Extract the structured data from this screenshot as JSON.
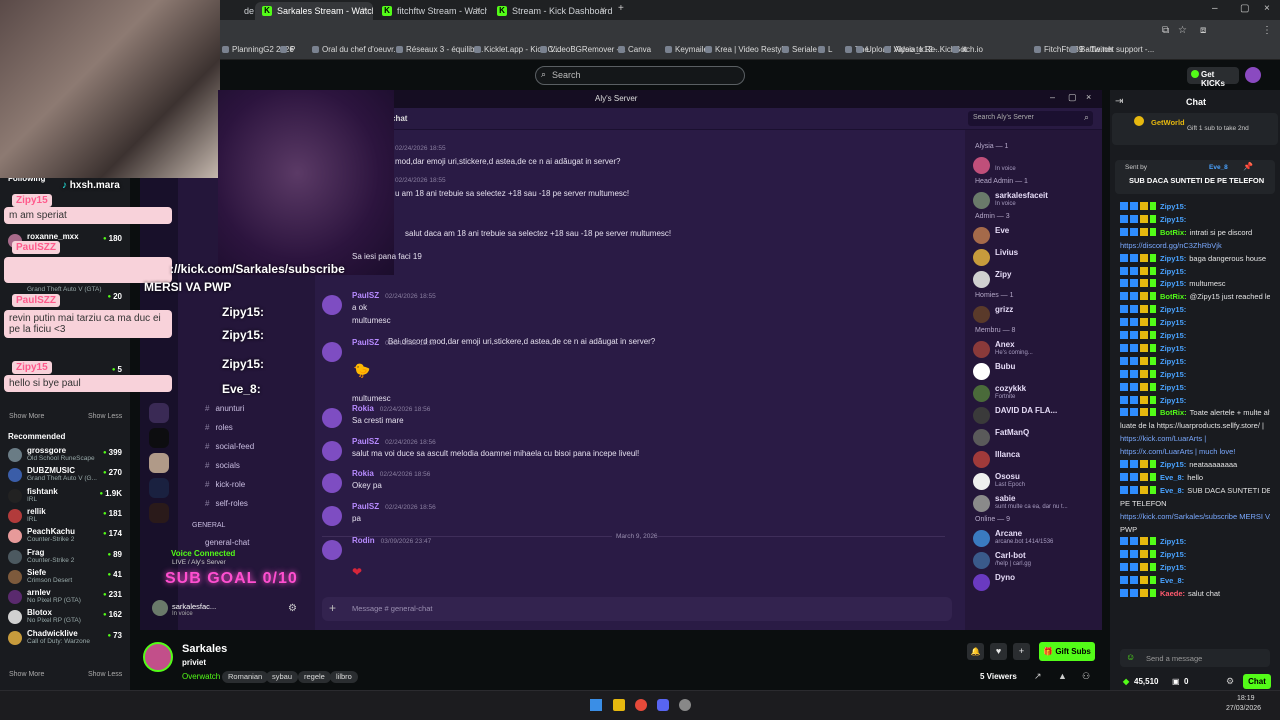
{
  "browser": {
    "tabs": [
      {
        "label": "de fa",
        "active": false
      },
      {
        "label": "Sarkales Stream - Watch Live o",
        "active": true
      },
      {
        "label": "fitchftw Stream - Watch Live o",
        "active": false
      },
      {
        "label": "Stream - Kick Dashboard",
        "active": false
      }
    ],
    "bookmarks": [
      "PlanningG2 2026",
      "P",
      "Oral du chef d'oeuvr...",
      "Réseaux 3 - équilibr...",
      "Kicklet.app - Kick C...",
      "VideoBGRemover -...",
      "Canva",
      "Keymailer",
      "Krea | Video Restyle",
      "Seriale",
      "L",
      "The",
      "Upload Video to Re...",
      "Alysia_k12 - KickBot",
      "itch.io",
      "FitchFtw89 - Twitch",
      "Battle.net support -..."
    ]
  },
  "kick": {
    "search_placeholder": "Search",
    "get_kicks": "Get KICKs",
    "sidebar": {
      "following_label": "Following",
      "recommended_label": "Recommended",
      "show_more": "Show More",
      "show_less": "Show Less",
      "following": [
        {
          "name": "roxanne_mxx",
          "game": "",
          "viewers": "180"
        },
        {
          "name": "PaulSZZ",
          "game": "Grand Theft Auto V (GTA)",
          "viewers": "20"
        },
        {
          "name": "",
          "game": "",
          "viewers": "5"
        }
      ],
      "recommended": [
        {
          "name": "grossgore",
          "game": "Old School RuneScape",
          "viewers": "399",
          "color": "#6a7c85"
        },
        {
          "name": "DUBZMUSIC",
          "game": "Grand Theft Auto V (G...",
          "viewers": "270",
          "color": "#3a5da8"
        },
        {
          "name": "fishtank",
          "game": "IRL",
          "viewers": "1.9K",
          "color": "#222222"
        },
        {
          "name": "rellik",
          "game": "IRL",
          "viewers": "181",
          "color": "#b23b3b"
        },
        {
          "name": "PeachKachu",
          "game": "Counter-Strike 2",
          "viewers": "174",
          "color": "#e79a9a"
        },
        {
          "name": "Frag",
          "game": "Counter-Strike 2",
          "viewers": "89",
          "color": "#4c5960"
        },
        {
          "name": "Siefe",
          "game": "Crimson Desert",
          "viewers": "41",
          "color": "#7d5a3c"
        },
        {
          "name": "arnlev",
          "game": "No Pixel RP (GTA)",
          "viewers": "231",
          "color": "#5a2a6e"
        },
        {
          "name": "Blotox",
          "game": "No Pixel RP (GTA)",
          "viewers": "162",
          "color": "#d0d0d0"
        },
        {
          "name": "Chadwicklive",
          "game": "Call of Duty: Warzone",
          "viewers": "73",
          "color": "#c79b3c"
        }
      ]
    },
    "streamer": {
      "name": "Sarkales",
      "title": "priviet",
      "category": "Overwatch",
      "tags": [
        "Romanian",
        "sybau",
        "regele",
        "lilbro"
      ],
      "viewers": "5 Viewers",
      "gift_subs": "Gift Subs"
    },
    "chat": {
      "title": "Chat",
      "pinned_user": "GetWorld",
      "pinned_text": "Gift 1 sub to take 2nd",
      "sent_by": "Sent by",
      "sent_by_user": "Eve_8",
      "announcement": "SUB DACA SUNTETI DE PE TELEFON",
      "messages": [
        {
          "user": "Zipy15:",
          "text": "",
          "color": "#4aa3ff"
        },
        {
          "user": "Zipy15:",
          "text": "",
          "color": "#4aa3ff"
        },
        {
          "user": "BotRix:",
          "text": "intrati si pe discord",
          "color": "#53fc18"
        },
        {
          "user": "",
          "text": "https://discord.gg/nC3ZhRbVjk",
          "color": "#7aa9ff"
        },
        {
          "user": "Zipy15:",
          "text": "baga dangerous house",
          "color": "#4aa3ff"
        },
        {
          "user": "Zipy15:",
          "text": "",
          "color": "#4aa3ff"
        },
        {
          "user": "Zipy15:",
          "text": "multumesc",
          "color": "#4aa3ff"
        },
        {
          "user": "BotRix:",
          "text": "@Zipy15 just reached level 16!",
          "color": "#53fc18"
        },
        {
          "user": "Zipy15:",
          "text": "",
          "color": "#4aa3ff"
        },
        {
          "user": "Zipy15:",
          "text": "",
          "color": "#4aa3ff"
        },
        {
          "user": "Zipy15:",
          "text": "",
          "color": "#4aa3ff"
        },
        {
          "user": "Zipy15:",
          "text": "",
          "color": "#4aa3ff"
        },
        {
          "user": "Zipy15:",
          "text": "",
          "color": "#4aa3ff"
        },
        {
          "user": "Zipy15:",
          "text": "",
          "color": "#4aa3ff"
        },
        {
          "user": "Zipy15:",
          "text": "",
          "color": "#4aa3ff"
        },
        {
          "user": "Zipy15:",
          "text": "",
          "color": "#4aa3ff"
        },
        {
          "user": "BotRix:",
          "text": "Toate alertele + multe altele sunt",
          "color": "#53fc18"
        },
        {
          "user": "",
          "text": "luate de la https://luarproducts.sellfy.store/ |",
          "color": "#e4e4e4"
        },
        {
          "user": "",
          "text": "https://kick.com/LuarArts |",
          "color": "#7aa9ff"
        },
        {
          "user": "",
          "text": "https://x.com/LuarArts | much love!",
          "color": "#7aa9ff"
        },
        {
          "user": "Zipy15:",
          "text": "neataaaaaaaa",
          "color": "#4aa3ff"
        },
        {
          "user": "Eve_8:",
          "text": "hello",
          "color": "#4aa3ff"
        },
        {
          "user": "Eve_8:",
          "text": "SUB DACA SUNTETI DE",
          "color": "#4aa3ff"
        },
        {
          "user": "",
          "text": "PE TELEFON",
          "color": "#e4e4e4"
        },
        {
          "user": "",
          "text": "https://kick.com/Sarkales/subscribe MERSI VA",
          "color": "#7aa9ff"
        },
        {
          "user": "",
          "text": "PWP",
          "color": "#e4e4e4"
        },
        {
          "user": "Zipy15:",
          "text": "",
          "color": "#4aa3ff"
        },
        {
          "user": "Zipy15:",
          "text": "",
          "color": "#4aa3ff"
        },
        {
          "user": "Zipy15:",
          "text": "",
          "color": "#4aa3ff"
        },
        {
          "user": "Eve_8:",
          "text": "",
          "color": "#4aa3ff"
        },
        {
          "user": "Kaede:",
          "text": "salut chat",
          "color": "#ff5a6e"
        }
      ],
      "input_placeholder": "Send a message",
      "points": "45,510",
      "zero": "0",
      "chat_button": "Chat"
    }
  },
  "overlay": {
    "tiktok": "hxsh.mara",
    "bubbles": [
      {
        "user": "Zipy15",
        "text": "m am speriat"
      },
      {
        "user": "PaulSZZ",
        "text": ""
      },
      {
        "user": "PaulSZZ",
        "text": "revin putin mai tarziu ca ma duc ei pe la ficiu <3"
      },
      {
        "user": "Zipy15",
        "text": "hello si bye paul"
      }
    ],
    "subscribe_link": "://kick.com/Sarkales/subscribe",
    "mersi": "MERSI VA PWP",
    "subgoal": "SUB GOAL 0/10",
    "alerts": [
      "Zipy15:",
      "Zipy15:",
      "Zipy15:",
      "Eve_8:"
    ]
  },
  "discord": {
    "window_title": "Aly's Server",
    "search_placeholder": "Search Aly's Server",
    "channel_header": "chat",
    "channels": [
      "anunturi",
      "roles",
      "social-feed",
      "socials",
      "kick-role",
      "self-roles"
    ],
    "category_general": "GENERAL",
    "general_chat": "general-chat",
    "voice_connected": "Voice Connected",
    "voice_server": "LIVE / Aly's Server",
    "user_name": "sarkalesfac...",
    "user_status": "In voice",
    "message_placeholder": "Message # general-chat",
    "date_divider": "March 9, 2026",
    "messages": [
      {
        "name": "",
        "ts": "02/24/2026 18:55",
        "text": "mod,dar emoji uri,stickere,d astea,de ce n ai adăugat in server?"
      },
      {
        "name": "",
        "ts": "02/24/2026 18:55",
        "text": "u am 18 ani trebuie sa selectez +18 sau -18 pe server multumesc!"
      },
      {
        "name": "",
        "ts": "",
        "text": "salut daca am 18 ani trebuie sa selectez +18 sau -18 pe server multumesc!"
      },
      {
        "name": "",
        "ts": "",
        "text": "Sa iesi pana faci 19"
      },
      {
        "name": "PaulSZ",
        "ts": "02/24/2026 18:55",
        "text": "a ok"
      },
      {
        "name": "",
        "ts": "",
        "text": "multumesc"
      },
      {
        "name": "",
        "ts": "",
        "text": "Bai discord mod,dar emoji uri,stickere,d astea,de ce n ai adăugat in server?"
      },
      {
        "name": "PaulSZ",
        "ts": "02/24/2026 18:56",
        "text": ""
      },
      {
        "name": "",
        "ts": "",
        "text": "multumesc"
      },
      {
        "name": "Rokia",
        "ts": "02/24/2026 18:56",
        "text": "Sa cresti mare"
      },
      {
        "name": "PaulSZ",
        "ts": "02/24/2026 18:56",
        "text": "salut ma voi duce sa ascult melodia doamnei mihaela cu bisoi pana incepe liveul!"
      },
      {
        "name": "Rokia",
        "ts": "02/24/2026 18:56",
        "text": "Okey pa"
      },
      {
        "name": "PaulSZ",
        "ts": "02/24/2026 18:56",
        "text": "pa"
      },
      {
        "name": "Rodin",
        "ts": "03/09/2026 23:47",
        "text": ""
      }
    ],
    "members": [
      {
        "section": "Alysia — 1"
      },
      {
        "name": "",
        "status": "In voice",
        "color": "#c04f7a"
      },
      {
        "section": "Head Admin — 1"
      },
      {
        "name": "sarkalesfaceit",
        "status": "In voice",
        "color": "#6a7a6a"
      },
      {
        "section": "Admin — 3"
      },
      {
        "name": "Eve",
        "status": "",
        "color": "#a56a4a"
      },
      {
        "name": "Livius",
        "status": "",
        "color": "#c79b3c"
      },
      {
        "name": "Zipy",
        "status": "",
        "color": "#d0d0d0"
      },
      {
        "section": "Homies — 1"
      },
      {
        "name": "grizz",
        "status": "",
        "color": "#5a3a2a"
      },
      {
        "section": "Membru — 8"
      },
      {
        "name": "Anex",
        "status": "He's coming...",
        "color": "#8a3a3a"
      },
      {
        "name": "Bubu",
        "status": "",
        "color": "#ffffff"
      },
      {
        "name": "cozykkk",
        "status": "Fortnite",
        "color": "#4a6a3a"
      },
      {
        "name": "DAVID DA FLA...",
        "status": "",
        "color": "#3a3a3a"
      },
      {
        "name": "FatManQ",
        "status": "",
        "color": "#5a5a5a"
      },
      {
        "name": "Illanca",
        "status": "",
        "color": "#a03a3a"
      },
      {
        "name": "Ososu",
        "status": "Last Epoch",
        "color": "#eeeeee"
      },
      {
        "name": "sabie",
        "status": "sunt multe ca ea, dar nu t...",
        "color": "#8a8a8a"
      },
      {
        "section": "Online — 9"
      },
      {
        "name": "Arcane",
        "status": "arcane.bot 1414/1536",
        "color": "#3a7ac0"
      },
      {
        "name": "Carl-bot",
        "status": "/help | carl.gg",
        "color": "#3a5a8a"
      },
      {
        "name": "Dyno",
        "status": "",
        "color": "#6a3ac0"
      }
    ]
  },
  "taskbar": {
    "time": "18:19",
    "date": "27/03/2026"
  }
}
